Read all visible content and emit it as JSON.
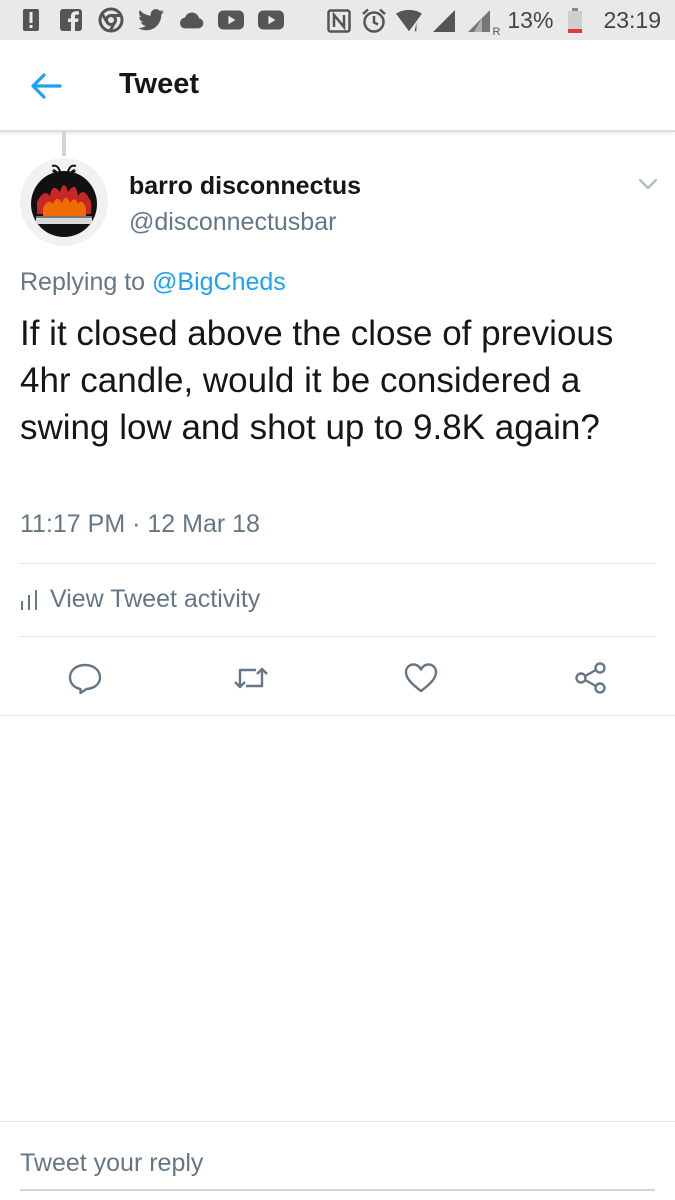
{
  "status_bar": {
    "battery_text": "13%",
    "time": "23:19",
    "left_icons": [
      "alert-icon",
      "facebook-icon",
      "chrome-icon",
      "twitter-icon",
      "cloud-icon",
      "youtube-icon",
      "youtube-icon"
    ],
    "right_icons": [
      "nfc-icon",
      "alarm-icon",
      "wifi-icon",
      "signal-icon",
      "signal-roaming-icon",
      "battery-icon"
    ],
    "roaming_label": "R"
  },
  "header": {
    "title": "Tweet",
    "back_icon": "arrow-left-icon",
    "accent_color": "#1da1f2"
  },
  "tweet": {
    "author_name": "barro disconnectus",
    "author_handle": "@disconnectusbar",
    "replying_prefix": "Replying to",
    "replying_to": "@BigCheds",
    "text": "If it closed above the close of previous 4hr candle, would it be considered a swing low and shot up to 9.8K again?",
    "timestamp": "11:17 PM · 12 Mar 18"
  },
  "activity": {
    "label": "View Tweet activity",
    "icon": "bar-chart-icon"
  },
  "actions": [
    "reply-icon",
    "retweet-icon",
    "like-icon",
    "share-icon"
  ],
  "reply_box": {
    "placeholder": "Tweet your reply",
    "value": ""
  }
}
